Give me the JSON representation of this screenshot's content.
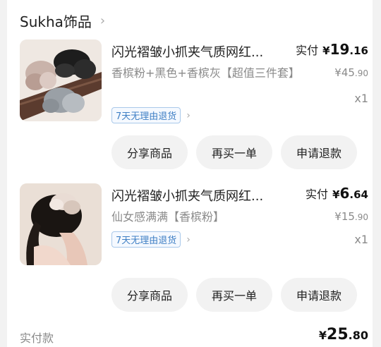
{
  "shop": {
    "name": "Sukha饰品",
    "chevron": "›"
  },
  "items": [
    {
      "title": "闪光褶皱小抓夹气质网红...",
      "sku": "香槟粉+黑色+香槟灰【超值三件套】",
      "pay_label": "实付",
      "pay_currency": "¥",
      "pay_int": "19",
      "pay_dec": ".16",
      "orig_currency": "¥",
      "orig_int": "45",
      "orig_dec": ".90",
      "qty": "x1",
      "tag": "7天无理由退货",
      "buttons": [
        "分享商品",
        "再买一单",
        "申请退款"
      ]
    },
    {
      "title": "闪光褶皱小抓夹气质网红...",
      "sku": "仙女感满满【香槟粉】",
      "pay_label": "实付",
      "pay_currency": "¥",
      "pay_int": "6",
      "pay_dec": ".64",
      "orig_currency": "¥",
      "orig_int": "15",
      "orig_dec": ".90",
      "qty": "x1",
      "tag": "7天无理由退货",
      "buttons": [
        "分享商品",
        "再买一单",
        "申请退款"
      ]
    }
  ],
  "footer": {
    "label": "实付款",
    "currency": "¥",
    "int": "25",
    "dec": ".80"
  },
  "icons": {
    "tag_chevron": "›"
  }
}
